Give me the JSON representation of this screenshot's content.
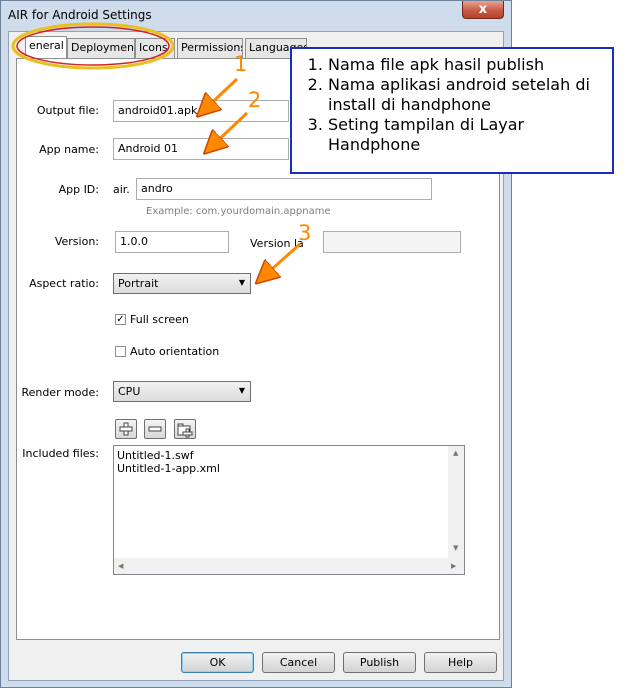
{
  "window": {
    "title": "AIR for Android Settings",
    "close_symbol": "x"
  },
  "tabs": [
    "eneral",
    "Deployment",
    "Icons",
    "Permissions",
    "Languages"
  ],
  "form": {
    "output_file": {
      "label": "Output file:",
      "value": "android01.apk"
    },
    "app_name": {
      "label": "App name:",
      "value": "Android 01"
    },
    "app_id": {
      "label": "App ID:",
      "prefix": "air.",
      "value": "andro",
      "hint": "Example: com.yourdomain.appname"
    },
    "version": {
      "label": "Version:",
      "value": "1.0.0"
    },
    "version_label": {
      "label": "Version la"
    },
    "aspect_ratio": {
      "label": "Aspect ratio:",
      "value": "Portrait"
    },
    "full_screen": {
      "label": "Full screen",
      "checked": true
    },
    "auto_orientation": {
      "label": "Auto orientation",
      "checked": false
    },
    "render_mode": {
      "label": "Render mode:",
      "value": "CPU"
    },
    "included_files": {
      "label": "Included files:",
      "items": [
        "Untitled-1.swf",
        "Untitled-1-app.xml"
      ]
    }
  },
  "buttons": {
    "ok": "OK",
    "cancel": "Cancel",
    "publish": "Publish",
    "help": "Help"
  },
  "annotation": {
    "items": [
      "Nama file apk hasil publish",
      "Nama aplikasi android setelah di install di handphone",
      "Seting tampilan di Layar Handphone"
    ],
    "markers": [
      "1",
      "2",
      "3"
    ],
    "colors": {
      "highlight": "#ff8800",
      "box_border": "#1a2ebd",
      "ellipse": "#e8c020"
    }
  }
}
